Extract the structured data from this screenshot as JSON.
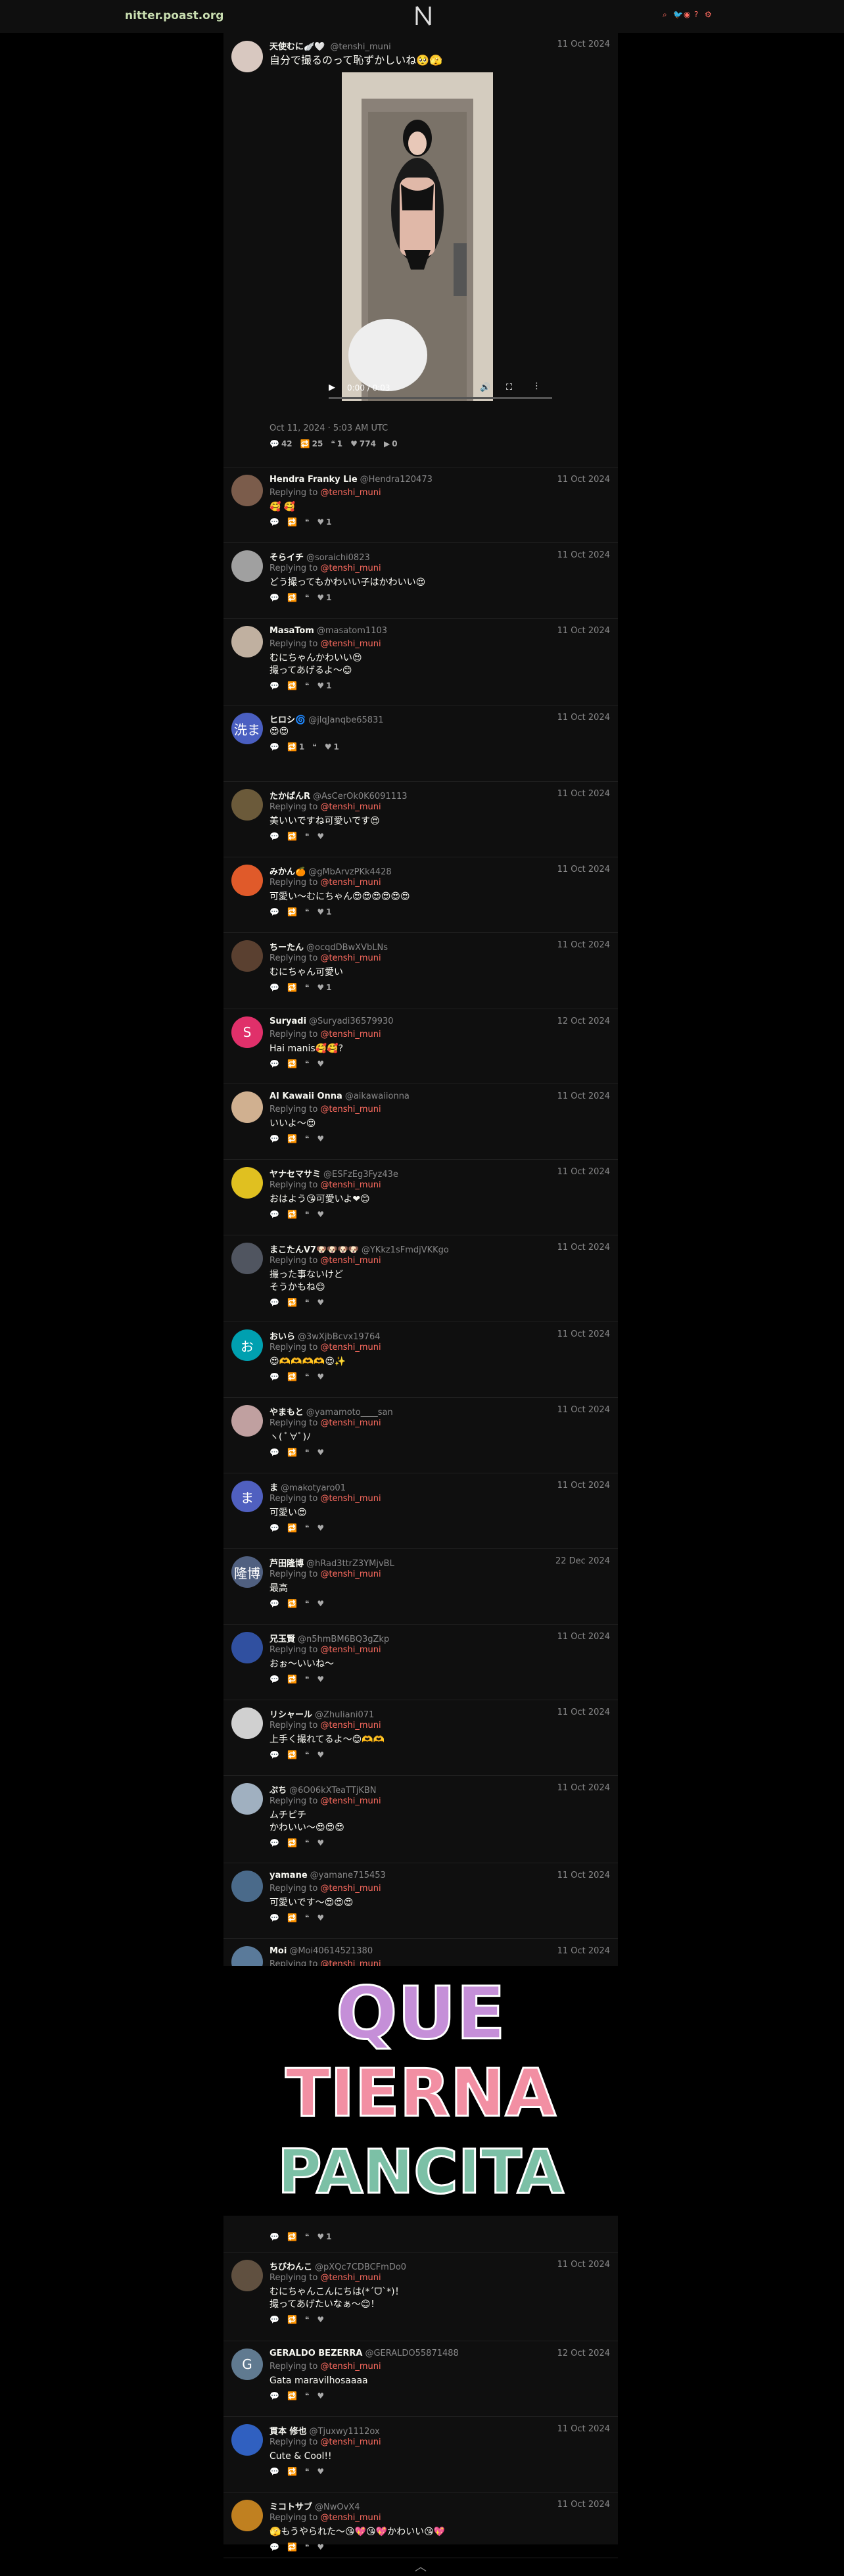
{
  "nav": {
    "brand": "nitter.poast.org",
    "logo_letter": "N"
  },
  "main": {
    "fullname": "天使むに🪽🤍",
    "username": "@tenshi_muni",
    "date": "11 Oct 2024",
    "text": "自分で撮るのって恥ずかしいね🥺🫣",
    "video_time": "0:00 / 0:03",
    "published": "Oct 11, 2024 · 5:03 AM UTC",
    "stats": {
      "replies": "42",
      "retweets": "25",
      "quotes": "1",
      "likes": "774",
      "views": "0"
    }
  },
  "reply_prefix": "Replying to",
  "reply_target": "@tenshi_muni",
  "replies": [
    {
      "name": "Hendra Franky Lie",
      "user": "@Hendra120473",
      "date": "11 Oct 2024",
      "text": "🥰 🥰",
      "likes": "1",
      "color": "#7b5c4b"
    },
    {
      "name": "そらイチ",
      "user": "@soraichi0823",
      "date": "11 Oct 2024",
      "text": "どう撮ってもかわいい子はかわいい😍",
      "likes": "1",
      "color": "#a0a0a0"
    },
    {
      "name": "MasaTom",
      "user": "@masatom1103",
      "date": "11 Oct 2024",
      "text": "むにちゃんかわいい😍\n撮ってあげるよ〜😊",
      "likes": "1",
      "color": "#c0b0a0"
    },
    {
      "name": "ヒロシ🌀",
      "user": "@jlqJanqbe65831",
      "date": "11 Oct 2024",
      "text": "😍😍",
      "likes": "1",
      "color": "#4a5fc1",
      "initial": "洗ま",
      "no_reply": true,
      "rt": "1"
    },
    {
      "name": "たかぱんR",
      "user": "@AsCerOk0K6091113",
      "date": "11 Oct 2024",
      "text": "美いいですね可愛いです😍",
      "likes": "",
      "color": "#6b5a3a"
    },
    {
      "name": "みかん🍊",
      "user": "@gMbArvzPKk4428",
      "date": "11 Oct 2024",
      "text": "可愛い〜むにちゃん😍😍😍😍😍😍",
      "likes": "1",
      "color": "#e05a2a"
    },
    {
      "name": "ちーたん",
      "user": "@ocqdDBwXVbLNs",
      "date": "11 Oct 2024",
      "text": "むにちゃん可愛い",
      "likes": "1",
      "color": "#5a4030"
    },
    {
      "name": "Suryadi",
      "user": "@Suryadi36579930",
      "date": "12 Oct 2024",
      "text": "Hai manis🥰🥰?",
      "likes": "",
      "color": "#e0306a",
      "initial": "S"
    },
    {
      "name": "AI Kawaii Onna",
      "user": "@aikawaiionna",
      "date": "11 Oct 2024",
      "text": "いいよ〜😍",
      "likes": "",
      "color": "#d0b090"
    },
    {
      "name": "ヤナセマサミ",
      "user": "@ESFzEg3Fyz43e",
      "date": "11 Oct 2024",
      "text": "おはよう😘可愛いよ❤😊",
      "likes": "",
      "color": "#e0c020"
    },
    {
      "name": "まこたんV7🐶🐶🐶🐶",
      "user": "@YKkz1sFmdjVKKgo",
      "date": "11 Oct 2024",
      "text": "撮った事ないけど\nそうかもね😊",
      "likes": "",
      "color": "#505560"
    },
    {
      "name": "おいら",
      "user": "@3wXjbBcvx19764",
      "date": "11 Oct 2024",
      "text": "😍🫶🫶🫶🫶😍✨",
      "likes": "",
      "color": "#00a0b0",
      "initial": "お"
    },
    {
      "name": "やまもと",
      "user": "@yamamoto____san",
      "date": "11 Oct 2024",
      "text": "ヽ( ﾟ∀ﾟ)ﾉ",
      "likes": "",
      "color": "#c0a0a0"
    },
    {
      "name": "ま",
      "user": "@makotyaro01",
      "date": "11 Oct 2024",
      "text": "可愛い😍",
      "likes": "",
      "color": "#5060c0",
      "initial": "ま"
    },
    {
      "name": "芦田隆博",
      "user": "@hRad3ttrZ3YMjvBL",
      "date": "22 Dec 2024",
      "text": "最高",
      "likes": "",
      "color": "#506080",
      "initial": "隆博"
    },
    {
      "name": "兄玉賢",
      "user": "@n5hmBM6BQ3gZkp",
      "date": "11 Oct 2024",
      "text": "おぉ〜いいね〜",
      "likes": "",
      "color": "#3050a0"
    },
    {
      "name": "リシャール",
      "user": "@Zhuliani071",
      "date": "11 Oct 2024",
      "text": "上手く撮れてるよ〜😊🫶🫶",
      "likes": "",
      "color": "#d0d0d0"
    },
    {
      "name": "ぷち",
      "user": "@6O06kXTeaTTjKBN",
      "date": "11 Oct 2024",
      "text": "ムチピチ\nかわいい〜😍😍😍",
      "likes": "",
      "color": "#a0b0c0"
    },
    {
      "name": "yamane",
      "user": "@yamane715453",
      "date": "11 Oct 2024",
      "text": "可愛いです〜😍😍😍",
      "likes": "",
      "color": "#4a6a8a"
    },
    {
      "name": "Moi",
      "user": "@Moi40614521380",
      "date": "11 Oct 2024",
      "text": "",
      "likes": "1",
      "color": "#5a7a9a"
    },
    {
      "name": "ちびわんこ",
      "user": "@pXQc7CDBCFmDo0",
      "date": "11 Oct 2024",
      "text": "むにちゃんこんにちは(*ˊᗜˋ*)！\n撮ってあげたいなぁ〜😊！",
      "likes": "",
      "color": "#605040"
    },
    {
      "name": "GERALDO BEZERRA",
      "user": "@GERALDO55871488",
      "date": "12 Oct 2024",
      "text": "Gata maravilhosaaaa",
      "likes": "",
      "color": "#607a90",
      "initial": "G"
    },
    {
      "name": "貫本 修也",
      "user": "@Tjuxwy1112ox",
      "date": "11 Oct 2024",
      "text": "Cute & Cool!!",
      "likes": "",
      "color": "#3060c0"
    },
    {
      "name": "ミコトサブ",
      "user": "@NwOvX4",
      "date": "11 Oct 2024",
      "text": "🫣もうやられた〜😘💖😘💖かわいい😘💖",
      "likes": "",
      "color": "#c08020"
    }
  ],
  "image_text": [
    "QUE",
    "TIERNA",
    "PANCITA"
  ]
}
